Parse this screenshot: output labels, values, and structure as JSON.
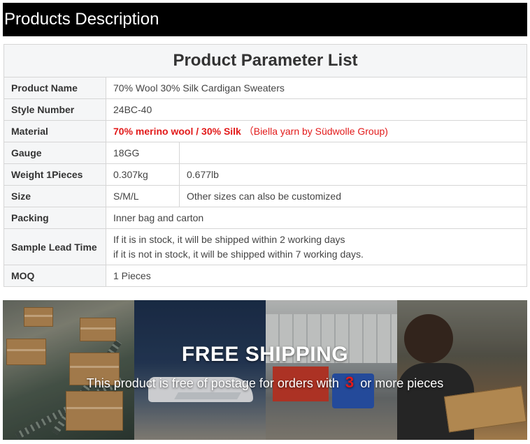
{
  "header": {
    "title": "Products Description"
  },
  "table": {
    "caption": "Product Parameter List",
    "rows": {
      "product_name": {
        "label": "Product Name",
        "value": "70% Wool 30% Silk Cardigan Sweaters"
      },
      "style_number": {
        "label": "Style Number",
        "value": "24BC-40"
      },
      "material": {
        "label": "Material",
        "value_bold": "70% merino wool  / 30% Silk",
        "value_note": "（Biella yarn by Südwolle Group)"
      },
      "gauge": {
        "label": "Gauge",
        "value": "18GG",
        "value2": ""
      },
      "weight": {
        "label": "Weight 1Pieces",
        "value": "0.307kg",
        "value2": "0.677lb"
      },
      "size": {
        "label": "Size",
        "value": "S/M/L",
        "value2": "Other sizes can also be customized"
      },
      "packing": {
        "label": "Packing",
        "value": "Inner bag and carton"
      },
      "sample_lead_time": {
        "label": "Sample Lead Time",
        "line1": "If it is in stock, it will be shipped within 2 working days",
        "line2": "if it is not in stock, it will be shipped within 7 working days."
      },
      "moq": {
        "label": "MOQ",
        "value": "1 Pieces"
      }
    }
  },
  "banner": {
    "title": "FREE SHIPPING",
    "subtitle_before": "This product is free of postage for orders with",
    "subtitle_number": "3",
    "subtitle_after": "or more pieces"
  },
  "colors": {
    "header_bg": "#000000",
    "accent_red": "#e21a1a",
    "label_bg": "#f5f6f7"
  }
}
